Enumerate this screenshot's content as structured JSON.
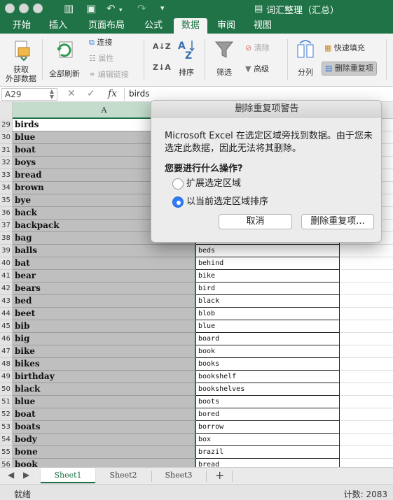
{
  "window": {
    "title": "词汇整理（汇总）"
  },
  "tabs": [
    "开始",
    "插入",
    "页面布局",
    "公式",
    "数据",
    "审阅",
    "视图"
  ],
  "ribbon": {
    "get_external_data": "获取\n外部数据",
    "refresh_all": "全部刷新",
    "connections": "连接",
    "properties": "属性",
    "edit_links": "编辑链接",
    "sort": "排序",
    "filter": "筛选",
    "clear": "清除",
    "advanced": "高级",
    "text_to_columns": "分列",
    "flash_fill": "快速填充",
    "remove_duplicates": "删除重复项"
  },
  "formula_bar": {
    "name_box": "A29",
    "fx": "fx",
    "content": "birds"
  },
  "grid": {
    "column_a_header": "A",
    "rows": [
      {
        "num": "29",
        "a": "birds",
        "b": ""
      },
      {
        "num": "30",
        "a": "blue",
        "b": ""
      },
      {
        "num": "31",
        "a": "boat",
        "b": ""
      },
      {
        "num": "32",
        "a": "boys",
        "b": ""
      },
      {
        "num": "33",
        "a": "bread",
        "b": ""
      },
      {
        "num": "34",
        "a": "brown",
        "b": ""
      },
      {
        "num": "35",
        "a": "bye",
        "b": ""
      },
      {
        "num": "36",
        "a": "back",
        "b": ""
      },
      {
        "num": "37",
        "a": "backpack",
        "b": ""
      },
      {
        "num": "38",
        "a": "bag",
        "b": ""
      },
      {
        "num": "39",
        "a": "balls",
        "b": "beds"
      },
      {
        "num": "40",
        "a": "bat",
        "b": "behind"
      },
      {
        "num": "41",
        "a": "bear",
        "b": "bike"
      },
      {
        "num": "42",
        "a": "bears",
        "b": "bird"
      },
      {
        "num": "43",
        "a": "bed",
        "b": "black"
      },
      {
        "num": "44",
        "a": "beet",
        "b": "blob"
      },
      {
        "num": "45",
        "a": "bib",
        "b": "blue"
      },
      {
        "num": "46",
        "a": "big",
        "b": "board"
      },
      {
        "num": "47",
        "a": "bike",
        "b": "book"
      },
      {
        "num": "48",
        "a": "bikes",
        "b": "books"
      },
      {
        "num": "49",
        "a": "birthday",
        "b": "bookshelf"
      },
      {
        "num": "50",
        "a": "black",
        "b": "bookshelves"
      },
      {
        "num": "51",
        "a": "blue",
        "b": "boots"
      },
      {
        "num": "52",
        "a": "boat",
        "b": "bored"
      },
      {
        "num": "53",
        "a": "boats",
        "b": "borrow"
      },
      {
        "num": "54",
        "a": "body",
        "b": "box"
      },
      {
        "num": "55",
        "a": "bone",
        "b": "brazil"
      },
      {
        "num": "56",
        "a": "book",
        "b": "bread"
      }
    ]
  },
  "sheets": [
    "Sheet1",
    "Sheet2",
    "Sheet3"
  ],
  "status": {
    "ready": "就绪",
    "count": "计数: 2083"
  },
  "dialog": {
    "title": "删除重复项警告",
    "message": "Microsoft Excel 在选定区域旁找到数据。由于您未选定此数据，因此无法将其删除。",
    "question": "您要进行什么操作?",
    "option_expand": "扩展选定区域",
    "option_current": "以当前选定区域排序",
    "cancel": "取消",
    "remove": "删除重复项..."
  },
  "colors": {
    "accent": "#1f7346",
    "selection": "#bfbfbf",
    "radio": "#2f7cf6"
  }
}
